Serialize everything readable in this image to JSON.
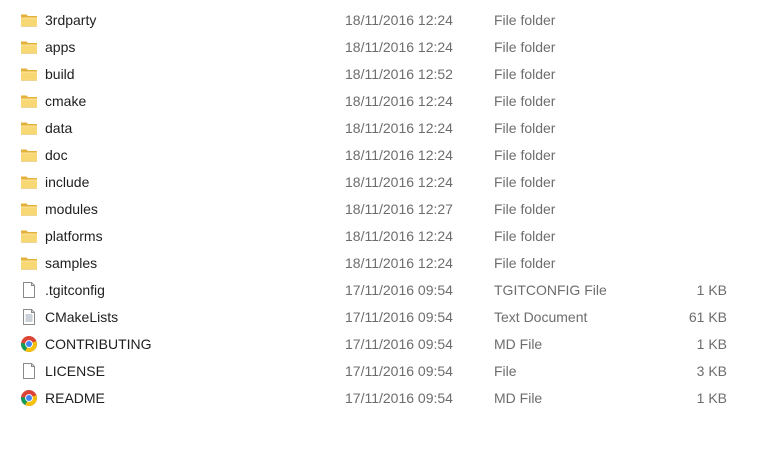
{
  "files": [
    {
      "name": "3rdparty",
      "date": "18/11/2016 12:24",
      "type": "File folder",
      "size": "",
      "icon": "folder-icon"
    },
    {
      "name": "apps",
      "date": "18/11/2016 12:24",
      "type": "File folder",
      "size": "",
      "icon": "folder-icon"
    },
    {
      "name": "build",
      "date": "18/11/2016 12:52",
      "type": "File folder",
      "size": "",
      "icon": "folder-icon"
    },
    {
      "name": "cmake",
      "date": "18/11/2016 12:24",
      "type": "File folder",
      "size": "",
      "icon": "folder-icon"
    },
    {
      "name": "data",
      "date": "18/11/2016 12:24",
      "type": "File folder",
      "size": "",
      "icon": "folder-icon"
    },
    {
      "name": "doc",
      "date": "18/11/2016 12:24",
      "type": "File folder",
      "size": "",
      "icon": "folder-icon"
    },
    {
      "name": "include",
      "date": "18/11/2016 12:24",
      "type": "File folder",
      "size": "",
      "icon": "folder-icon"
    },
    {
      "name": "modules",
      "date": "18/11/2016 12:27",
      "type": "File folder",
      "size": "",
      "icon": "folder-icon"
    },
    {
      "name": "platforms",
      "date": "18/11/2016 12:24",
      "type": "File folder",
      "size": "",
      "icon": "folder-icon"
    },
    {
      "name": "samples",
      "date": "18/11/2016 12:24",
      "type": "File folder",
      "size": "",
      "icon": "folder-icon"
    },
    {
      "name": ".tgitconfig",
      "date": "17/11/2016 09:54",
      "type": "TGITCONFIG File",
      "size": "1 KB",
      "icon": "blank-file-icon"
    },
    {
      "name": "CMakeLists",
      "date": "17/11/2016 09:54",
      "type": "Text Document",
      "size": "61 KB",
      "icon": "text-document-icon"
    },
    {
      "name": "CONTRIBUTING",
      "date": "17/11/2016 09:54",
      "type": "MD File",
      "size": "1 KB",
      "icon": "chrome-icon"
    },
    {
      "name": "LICENSE",
      "date": "17/11/2016 09:54",
      "type": "File",
      "size": "3 KB",
      "icon": "blank-file-icon"
    },
    {
      "name": "README",
      "date": "17/11/2016 09:54",
      "type": "MD File",
      "size": "1 KB",
      "icon": "chrome-icon"
    }
  ]
}
